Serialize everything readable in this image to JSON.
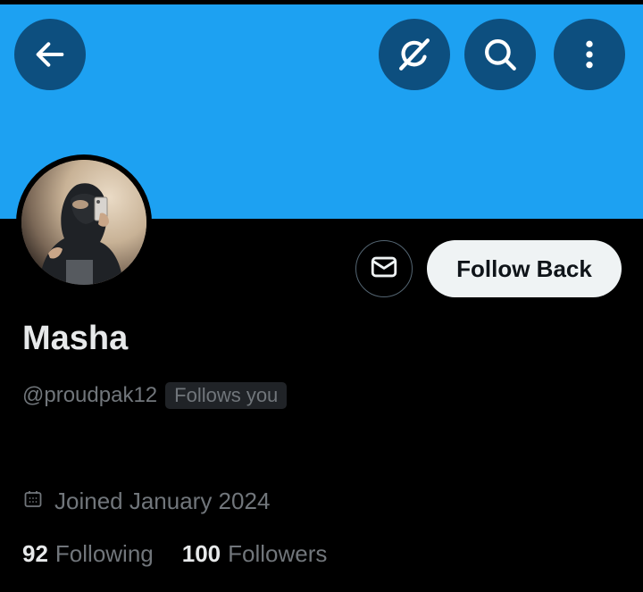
{
  "header": {
    "back_icon": "arrow-left-icon",
    "grok_icon": "grok-icon",
    "search_icon": "search-icon",
    "more_icon": "more-vertical-icon",
    "banner_color": "#1da1f2"
  },
  "profile": {
    "name": "Masha",
    "handle": "@proudpak12",
    "follows_you_label": "Follows you",
    "joined": "Joined January 2024",
    "message_icon": "mail-icon",
    "follow_back_label": "Follow Back"
  },
  "stats": {
    "following_count": "92",
    "following_label": "Following",
    "followers_count": "100",
    "followers_label": "Followers"
  }
}
